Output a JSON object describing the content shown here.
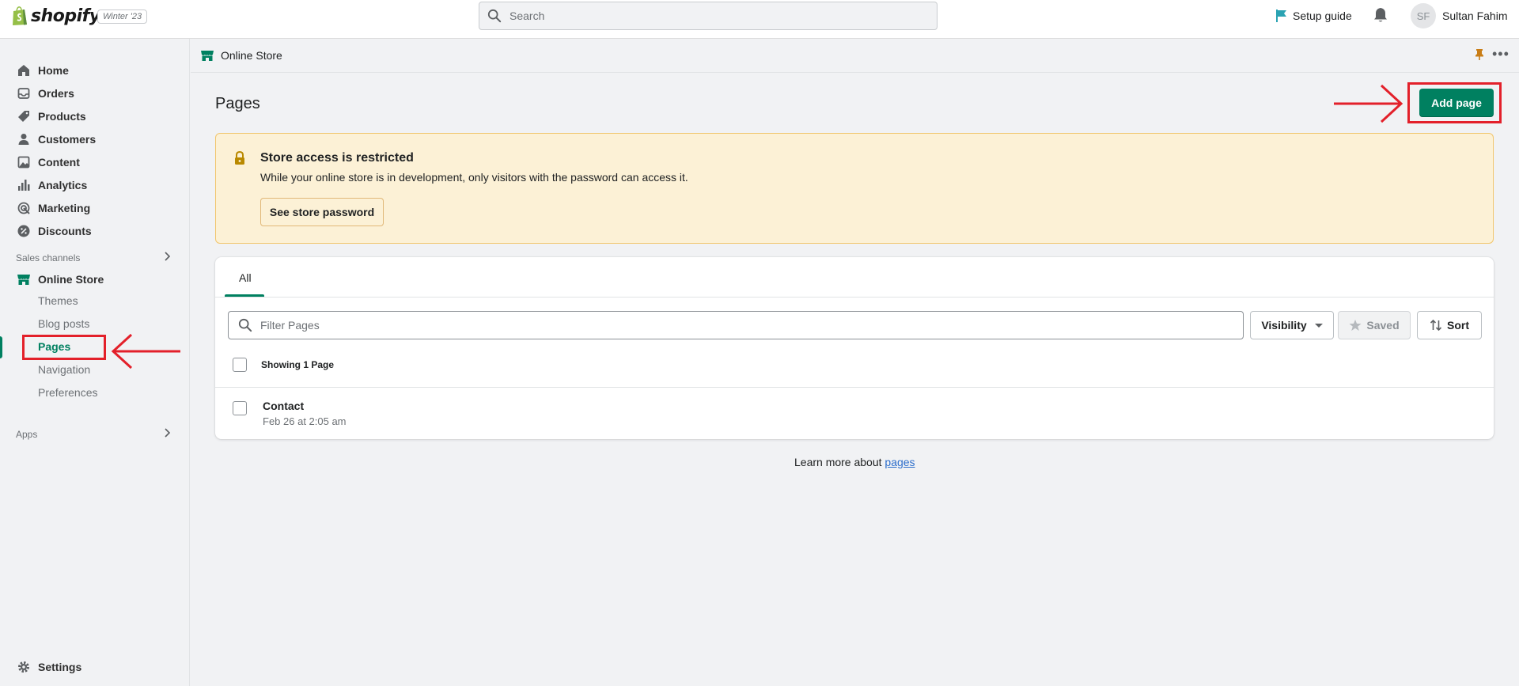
{
  "topbar": {
    "brand": "shopify",
    "edition_badge": "Winter '23",
    "search_placeholder": "Search",
    "setup_guide": "Setup guide",
    "user_initials": "SF",
    "user_name": "Sultan Fahim"
  },
  "sidebar": {
    "items": [
      {
        "label": "Home",
        "icon": "home-icon"
      },
      {
        "label": "Orders",
        "icon": "orders-icon"
      },
      {
        "label": "Products",
        "icon": "tag-icon"
      },
      {
        "label": "Customers",
        "icon": "person-icon"
      },
      {
        "label": "Content",
        "icon": "image-icon"
      },
      {
        "label": "Analytics",
        "icon": "bar-chart-icon"
      },
      {
        "label": "Marketing",
        "icon": "target-icon"
      },
      {
        "label": "Discounts",
        "icon": "discount-icon"
      }
    ],
    "sales_channels_label": "Sales channels",
    "online_store_label": "Online Store",
    "sub_items": [
      "Themes",
      "Blog posts",
      "Pages",
      "Navigation",
      "Preferences"
    ],
    "active_sub_item": "Pages",
    "apps_label": "Apps",
    "settings_label": "Settings"
  },
  "breadcrumb": {
    "label": "Online Store"
  },
  "page": {
    "title": "Pages",
    "add_button": "Add page"
  },
  "banner": {
    "title": "Store access is restricted",
    "text": "While your online store is in development, only visitors with the password can access it.",
    "button": "See store password"
  },
  "list": {
    "tab_all": "All",
    "filter_placeholder": "Filter Pages",
    "visibility_button": "Visibility",
    "saved_button": "Saved",
    "sort_button": "Sort",
    "showing_text": "Showing 1 Page",
    "rows": [
      {
        "title": "Contact",
        "date": "Feb 26 at 2:05 am"
      }
    ]
  },
  "footer": {
    "learn_prefix": "Learn more about ",
    "learn_link": "pages"
  },
  "colors": {
    "accent": "#008060",
    "annotation": "#e3202a",
    "banner_bg": "#fcf1d6"
  }
}
